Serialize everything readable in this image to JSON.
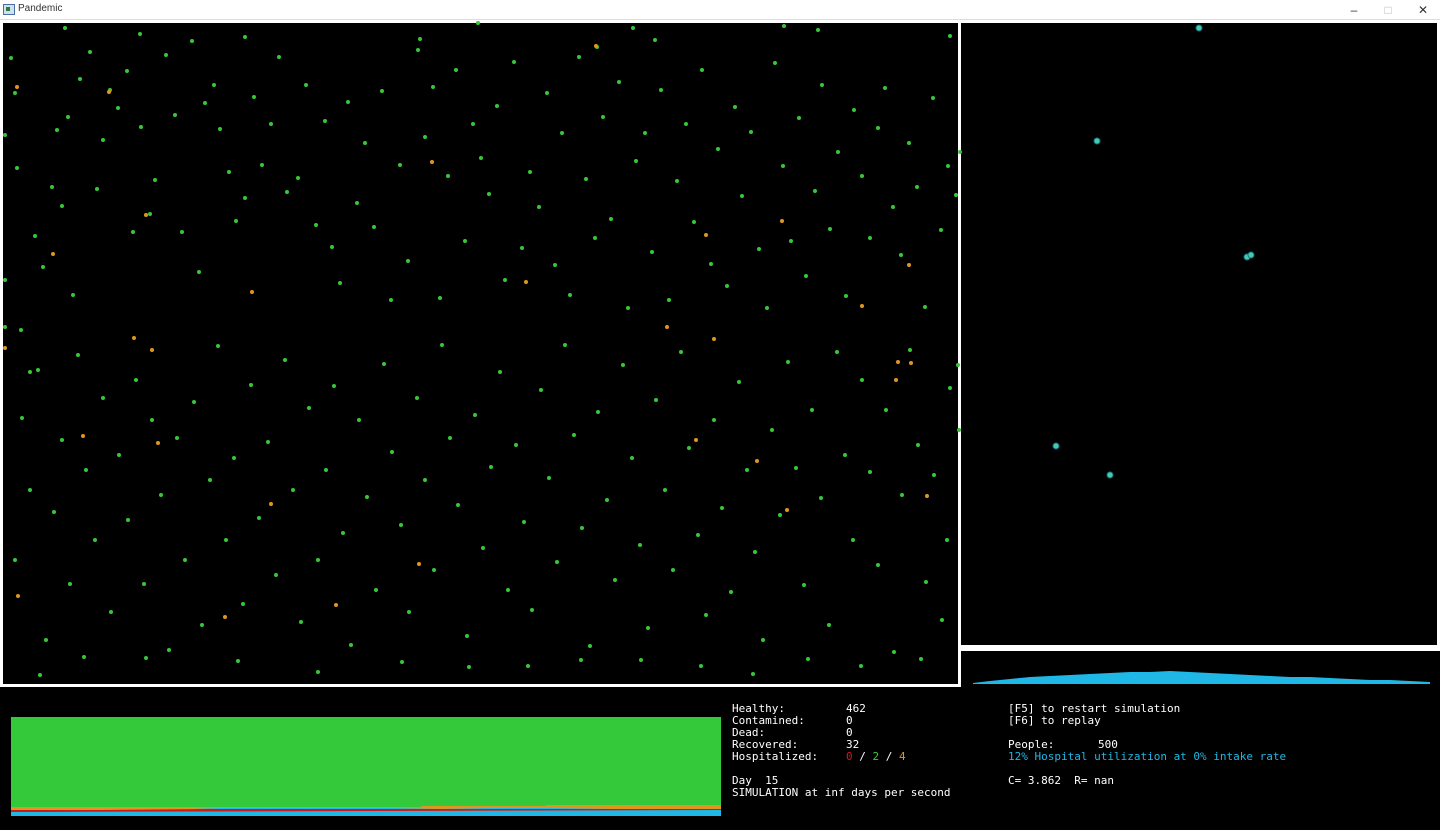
{
  "window": {
    "title": "Pandemic",
    "min_label": "–",
    "max_label": "□",
    "close_label": "✕"
  },
  "colors": {
    "healthy": "#35c935",
    "contaminated": "#e0961e",
    "hospital_patient": "#3fd0a8",
    "curve": "#1fb7e6",
    "dead": "#d01818"
  },
  "simulation": {
    "healthy_dots": [
      [
        11,
        58
      ],
      [
        15,
        93
      ],
      [
        17,
        168
      ],
      [
        21,
        330
      ],
      [
        30,
        372
      ],
      [
        35,
        236
      ],
      [
        43,
        267
      ],
      [
        52,
        187
      ],
      [
        57,
        130
      ],
      [
        62,
        206
      ],
      [
        68,
        117
      ],
      [
        73,
        295
      ],
      [
        80,
        79
      ],
      [
        90,
        52
      ],
      [
        97,
        189
      ],
      [
        103,
        140
      ],
      [
        110,
        90
      ],
      [
        118,
        108
      ],
      [
        127,
        71
      ],
      [
        133,
        232
      ],
      [
        141,
        127
      ],
      [
        150,
        214
      ],
      [
        155,
        180
      ],
      [
        166,
        55
      ],
      [
        175,
        115
      ],
      [
        182,
        232
      ],
      [
        192,
        41
      ],
      [
        199,
        272
      ],
      [
        205,
        103
      ],
      [
        214,
        85
      ],
      [
        220,
        129
      ],
      [
        229,
        172
      ],
      [
        236,
        221
      ],
      [
        245,
        198
      ],
      [
        254,
        97
      ],
      [
        262,
        165
      ],
      [
        271,
        124
      ],
      [
        279,
        57
      ],
      [
        287,
        192
      ],
      [
        298,
        178
      ],
      [
        306,
        85
      ],
      [
        316,
        225
      ],
      [
        325,
        121
      ],
      [
        332,
        247
      ],
      [
        340,
        283
      ],
      [
        348,
        102
      ],
      [
        357,
        203
      ],
      [
        365,
        143
      ],
      [
        374,
        227
      ],
      [
        382,
        91
      ],
      [
        391,
        300
      ],
      [
        400,
        165
      ],
      [
        408,
        261
      ],
      [
        418,
        50
      ],
      [
        425,
        137
      ],
      [
        433,
        87
      ],
      [
        440,
        298
      ],
      [
        448,
        176
      ],
      [
        456,
        70
      ],
      [
        465,
        241
      ],
      [
        473,
        124
      ],
      [
        481,
        158
      ],
      [
        489,
        194
      ],
      [
        497,
        106
      ],
      [
        505,
        280
      ],
      [
        514,
        62
      ],
      [
        522,
        248
      ],
      [
        530,
        172
      ],
      [
        539,
        207
      ],
      [
        547,
        93
      ],
      [
        555,
        265
      ],
      [
        562,
        133
      ],
      [
        570,
        295
      ],
      [
        579,
        57
      ],
      [
        586,
        179
      ],
      [
        595,
        238
      ],
      [
        603,
        117
      ],
      [
        611,
        219
      ],
      [
        619,
        82
      ],
      [
        628,
        308
      ],
      [
        636,
        161
      ],
      [
        645,
        133
      ],
      [
        652,
        252
      ],
      [
        661,
        90
      ],
      [
        669,
        300
      ],
      [
        677,
        181
      ],
      [
        686,
        124
      ],
      [
        694,
        222
      ],
      [
        702,
        70
      ],
      [
        711,
        264
      ],
      [
        718,
        149
      ],
      [
        727,
        286
      ],
      [
        735,
        107
      ],
      [
        742,
        196
      ],
      [
        751,
        132
      ],
      [
        759,
        249
      ],
      [
        767,
        308
      ],
      [
        775,
        63
      ],
      [
        783,
        166
      ],
      [
        791,
        241
      ],
      [
        799,
        118
      ],
      [
        806,
        276
      ],
      [
        815,
        191
      ],
      [
        822,
        85
      ],
      [
        830,
        229
      ],
      [
        838,
        152
      ],
      [
        846,
        296
      ],
      [
        854,
        110
      ],
      [
        862,
        176
      ],
      [
        870,
        238
      ],
      [
        878,
        128
      ],
      [
        885,
        88
      ],
      [
        893,
        207
      ],
      [
        901,
        255
      ],
      [
        909,
        143
      ],
      [
        917,
        187
      ],
      [
        925,
        307
      ],
      [
        933,
        98
      ],
      [
        941,
        230
      ],
      [
        948,
        166
      ],
      [
        15,
        560
      ],
      [
        22,
        418
      ],
      [
        30,
        490
      ],
      [
        38,
        370
      ],
      [
        46,
        640
      ],
      [
        54,
        512
      ],
      [
        62,
        440
      ],
      [
        70,
        584
      ],
      [
        78,
        355
      ],
      [
        86,
        470
      ],
      [
        95,
        540
      ],
      [
        103,
        398
      ],
      [
        111,
        612
      ],
      [
        119,
        455
      ],
      [
        128,
        520
      ],
      [
        136,
        380
      ],
      [
        144,
        584
      ],
      [
        152,
        420
      ],
      [
        161,
        495
      ],
      [
        169,
        650
      ],
      [
        177,
        438
      ],
      [
        185,
        560
      ],
      [
        194,
        402
      ],
      [
        202,
        625
      ],
      [
        210,
        480
      ],
      [
        218,
        346
      ],
      [
        226,
        540
      ],
      [
        234,
        458
      ],
      [
        243,
        604
      ],
      [
        251,
        385
      ],
      [
        259,
        518
      ],
      [
        268,
        442
      ],
      [
        276,
        575
      ],
      [
        285,
        360
      ],
      [
        293,
        490
      ],
      [
        301,
        622
      ],
      [
        309,
        408
      ],
      [
        318,
        560
      ],
      [
        326,
        470
      ],
      [
        334,
        386
      ],
      [
        343,
        533
      ],
      [
        351,
        645
      ],
      [
        359,
        420
      ],
      [
        367,
        497
      ],
      [
        376,
        590
      ],
      [
        384,
        364
      ],
      [
        392,
        452
      ],
      [
        401,
        525
      ],
      [
        409,
        612
      ],
      [
        417,
        398
      ],
      [
        425,
        480
      ],
      [
        434,
        570
      ],
      [
        442,
        345
      ],
      [
        450,
        438
      ],
      [
        458,
        505
      ],
      [
        467,
        636
      ],
      [
        475,
        415
      ],
      [
        483,
        548
      ],
      [
        491,
        467
      ],
      [
        500,
        372
      ],
      [
        508,
        590
      ],
      [
        516,
        445
      ],
      [
        524,
        522
      ],
      [
        532,
        610
      ],
      [
        541,
        390
      ],
      [
        549,
        478
      ],
      [
        557,
        562
      ],
      [
        565,
        345
      ],
      [
        574,
        435
      ],
      [
        582,
        528
      ],
      [
        590,
        646
      ],
      [
        598,
        412
      ],
      [
        607,
        500
      ],
      [
        615,
        580
      ],
      [
        623,
        365
      ],
      [
        632,
        458
      ],
      [
        640,
        545
      ],
      [
        648,
        628
      ],
      [
        656,
        400
      ],
      [
        665,
        490
      ],
      [
        673,
        570
      ],
      [
        681,
        352
      ],
      [
        689,
        448
      ],
      [
        698,
        535
      ],
      [
        706,
        615
      ],
      [
        714,
        420
      ],
      [
        722,
        508
      ],
      [
        731,
        592
      ],
      [
        739,
        382
      ],
      [
        747,
        470
      ],
      [
        755,
        552
      ],
      [
        763,
        640
      ],
      [
        772,
        430
      ],
      [
        780,
        515
      ],
      [
        788,
        362
      ],
      [
        796,
        468
      ],
      [
        804,
        585
      ],
      [
        812,
        410
      ],
      [
        821,
        498
      ],
      [
        829,
        625
      ],
      [
        837,
        352
      ],
      [
        845,
        455
      ],
      [
        853,
        540
      ],
      [
        862,
        380
      ],
      [
        870,
        472
      ],
      [
        878,
        565
      ],
      [
        886,
        410
      ],
      [
        894,
        652
      ],
      [
        902,
        495
      ],
      [
        910,
        350
      ],
      [
        918,
        445
      ],
      [
        926,
        582
      ],
      [
        934,
        475
      ],
      [
        942,
        620
      ],
      [
        950,
        388
      ],
      [
        947,
        540
      ],
      [
        40,
        675
      ],
      [
        84,
        657
      ],
      [
        146,
        658
      ],
      [
        238,
        661
      ],
      [
        318,
        672
      ],
      [
        402,
        662
      ],
      [
        469,
        667
      ],
      [
        528,
        666
      ],
      [
        581,
        660
      ],
      [
        641,
        660
      ],
      [
        701,
        666
      ],
      [
        753,
        674
      ],
      [
        808,
        659
      ],
      [
        861,
        666
      ],
      [
        921,
        659
      ],
      [
        956,
        195
      ],
      [
        960,
        152
      ],
      [
        958,
        365
      ],
      [
        959,
        430
      ],
      [
        5,
        280
      ],
      [
        5,
        135
      ],
      [
        5,
        327
      ],
      [
        65,
        28
      ],
      [
        140,
        34
      ],
      [
        245,
        37
      ],
      [
        420,
        39
      ],
      [
        478,
        23
      ],
      [
        597,
        47
      ],
      [
        633,
        28
      ],
      [
        655,
        40
      ],
      [
        784,
        26
      ],
      [
        818,
        30
      ],
      [
        950,
        36
      ]
    ],
    "contaminated_dots": [
      [
        17,
        87
      ],
      [
        109,
        92
      ],
      [
        146,
        215
      ],
      [
        53,
        254
      ],
      [
        252,
        292
      ],
      [
        432,
        162
      ],
      [
        526,
        282
      ],
      [
        667,
        327
      ],
      [
        706,
        235
      ],
      [
        714,
        339
      ],
      [
        782,
        221
      ],
      [
        862,
        306
      ],
      [
        898,
        362
      ],
      [
        909,
        265
      ],
      [
        911,
        363
      ],
      [
        896,
        380
      ],
      [
        134,
        338
      ],
      [
        152,
        350
      ],
      [
        83,
        436
      ],
      [
        158,
        443
      ],
      [
        271,
        504
      ],
      [
        336,
        605
      ],
      [
        419,
        564
      ],
      [
        225,
        617
      ],
      [
        18,
        596
      ],
      [
        696,
        440
      ],
      [
        757,
        461
      ],
      [
        787,
        510
      ],
      [
        927,
        496
      ],
      [
        596,
        46
      ],
      [
        5,
        348
      ]
    ],
    "patients": [
      [
        1199,
        28
      ],
      [
        1097,
        141
      ],
      [
        1247,
        257
      ],
      [
        1251,
        255
      ],
      [
        1056,
        446
      ],
      [
        1110,
        475
      ]
    ],
    "curve": [
      [
        973,
        683
      ],
      [
        990,
        681
      ],
      [
        1010,
        679
      ],
      [
        1030,
        677
      ],
      [
        1050,
        676
      ],
      [
        1070,
        675
      ],
      [
        1090,
        674
      ],
      [
        1110,
        673
      ],
      [
        1130,
        672
      ],
      [
        1150,
        672
      ],
      [
        1170,
        671
      ],
      [
        1190,
        672
      ],
      [
        1210,
        673
      ],
      [
        1230,
        674
      ],
      [
        1250,
        675
      ],
      [
        1270,
        676
      ],
      [
        1290,
        677
      ],
      [
        1310,
        677
      ],
      [
        1330,
        678
      ],
      [
        1350,
        679
      ],
      [
        1370,
        680
      ],
      [
        1390,
        680
      ],
      [
        1410,
        681
      ],
      [
        1430,
        682
      ]
    ]
  },
  "chart_data": {
    "type": "area",
    "days": 15,
    "series": [
      {
        "name": "Healthy",
        "color": "#33c93a"
      },
      {
        "name": "Contamined",
        "color": "#e0961e"
      },
      {
        "name": "Dead",
        "color": "#d01818"
      },
      {
        "name": "Recovered",
        "color": "#1fb7e6"
      }
    ]
  },
  "stats": {
    "healthy_label": "Healthy:",
    "healthy_value": "462",
    "contamined_label": "Contamined:",
    "contamined_value": "0",
    "dead_label": "Dead:",
    "dead_value": "0",
    "recovered_label": "Recovered:",
    "recovered_value": "32",
    "hospitalized_label": "Hospitalized:",
    "hosp_red": "0",
    "hosp_sep1": " / ",
    "hosp_green": "2",
    "hosp_sep2": " / ",
    "hosp_orange": "4",
    "day_label": "Day  15",
    "speed_text": "SIMULATION at inf days per second"
  },
  "help": {
    "restart": "[F5] to restart simulation",
    "replay": "[F6] to replay",
    "people_label": "People:",
    "people_value": "500",
    "hospital_util": "12% Hospital utilization at 0% intake rate",
    "cr_line": "C= 3.862  R= nan"
  }
}
